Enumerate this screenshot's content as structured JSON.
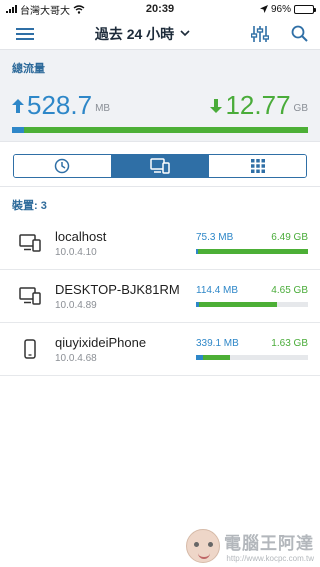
{
  "status_bar": {
    "carrier": "台灣大哥大",
    "time": "20:39",
    "battery": "96%",
    "battery_level": 0.96
  },
  "nav": {
    "title": "過去 24 小時",
    "menu_icon": "hamburger-menu-icon",
    "dropdown_icon": "chevron-down-icon",
    "filter_icon": "sliders-icon",
    "search_icon": "search-icon"
  },
  "summary": {
    "label": "總流量",
    "download_value": "528.7",
    "download_unit": "MB",
    "upload_value": "12.77",
    "upload_unit": "GB",
    "download_fraction": 0.04
  },
  "tabs": [
    {
      "icon": "clock-icon",
      "active": false
    },
    {
      "icon": "devices-icon",
      "active": true
    },
    {
      "icon": "grid-icon",
      "active": false
    }
  ],
  "devices_label": "裝置: 3",
  "devices": [
    {
      "name": "localhost",
      "ip": "10.0.4.10",
      "download": "75.3 MB",
      "upload": "6.49 GB",
      "icon": "desktop-mobile-icon",
      "download_fraction": 0.02,
      "upload_fraction": 0.98
    },
    {
      "name": "DESKTOP-BJK81RM",
      "ip": "10.0.4.89",
      "download": "114.4 MB",
      "upload": "4.65 GB",
      "icon": "desktop-mobile-icon",
      "download_fraction": 0.03,
      "upload_fraction": 0.69
    },
    {
      "name": "qiuyixideiPhone",
      "ip": "10.0.4.68",
      "download": "339.1 MB",
      "upload": "1.63 GB",
      "icon": "phone-icon",
      "download_fraction": 0.06,
      "upload_fraction": 0.24
    }
  ],
  "watermark": {
    "title": "電腦王阿達",
    "url": "http://www.kocpc.com.tw"
  },
  "colors": {
    "accent": "#2f6fa6",
    "download": "#2e87c8",
    "upload": "#4caf36"
  }
}
